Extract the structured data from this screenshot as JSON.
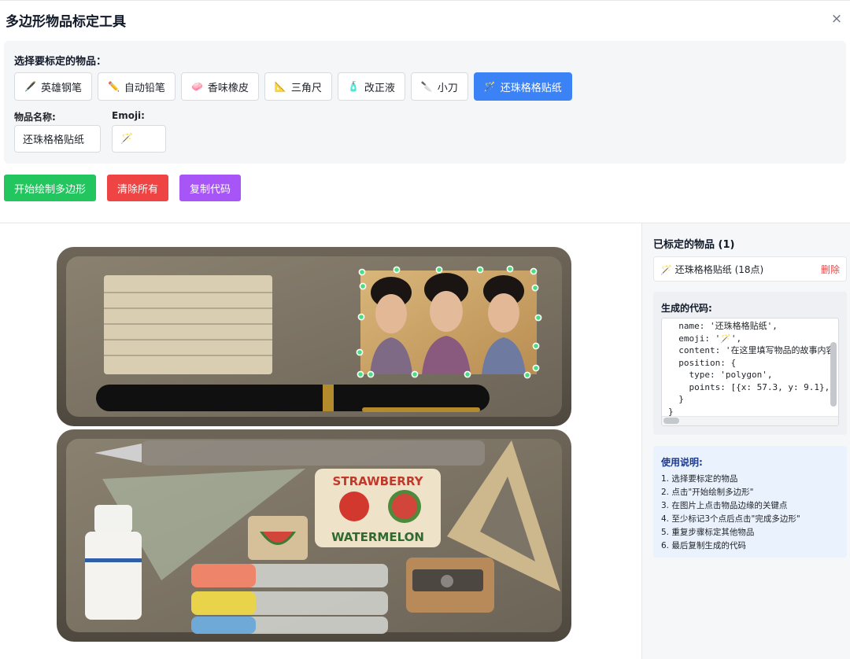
{
  "dialog": {
    "title": "多边形物品标定工具",
    "close_label": "×"
  },
  "selector": {
    "label": "选择要标定的物品：",
    "items": [
      {
        "emoji": "🖋️",
        "label": "英雄钢笔"
      },
      {
        "emoji": "✏️",
        "label": "自动铅笔"
      },
      {
        "emoji": "🧼",
        "label": "香味橡皮"
      },
      {
        "emoji": "📐",
        "label": "三角尺"
      },
      {
        "emoji": "🧴",
        "label": "改正液"
      },
      {
        "emoji": "🔪",
        "label": "小刀"
      },
      {
        "emoji": "🪄",
        "label": "还珠格格贴纸"
      }
    ],
    "active_index": 6
  },
  "fields": {
    "name_label": "物品名称:",
    "name_value": "还珠格格贴纸",
    "emoji_label": "Emoji:",
    "emoji_value": "🪄"
  },
  "actions": {
    "start": "开始绘制多边形",
    "clear": "清除所有",
    "copy": "复制代码"
  },
  "sidebar": {
    "marked_title": "已标定的物品 (1)",
    "marked_items": [
      {
        "label": "🪄 还珠格格贴纸 (18点)",
        "delete": "删除"
      }
    ],
    "code_title": "生成的代码:",
    "code_lines": [
      "  name: '还珠格格贴纸',",
      "  emoji: '🪄',",
      "  content: '在这里填写物品的故事内容",
      "  position: {",
      "    type: 'polygon',",
      "    points: [{x: 57.3, y: 9.1},",
      "  }",
      "}"
    ],
    "help_title": "使用说明:",
    "help_steps": [
      "1. 选择要标定的物品",
      "2. 点击\"开始绘制多边形\"",
      "3. 在图片上点击物品边缘的关键点",
      "4. 至少标记3个点后点击\"完成多边形\"",
      "5. 重复步骤标定其他物品",
      "6. 最后复制生成的代码"
    ]
  },
  "artwork": {
    "eraser_text_top": "STRAWBERRY",
    "eraser_text_bottom": "WATERMELON"
  },
  "colors": {
    "primary": "#3b82f6",
    "success": "#22c55e",
    "danger": "#ef4444",
    "accent": "#a855f7",
    "vertex": "#4ade80"
  }
}
